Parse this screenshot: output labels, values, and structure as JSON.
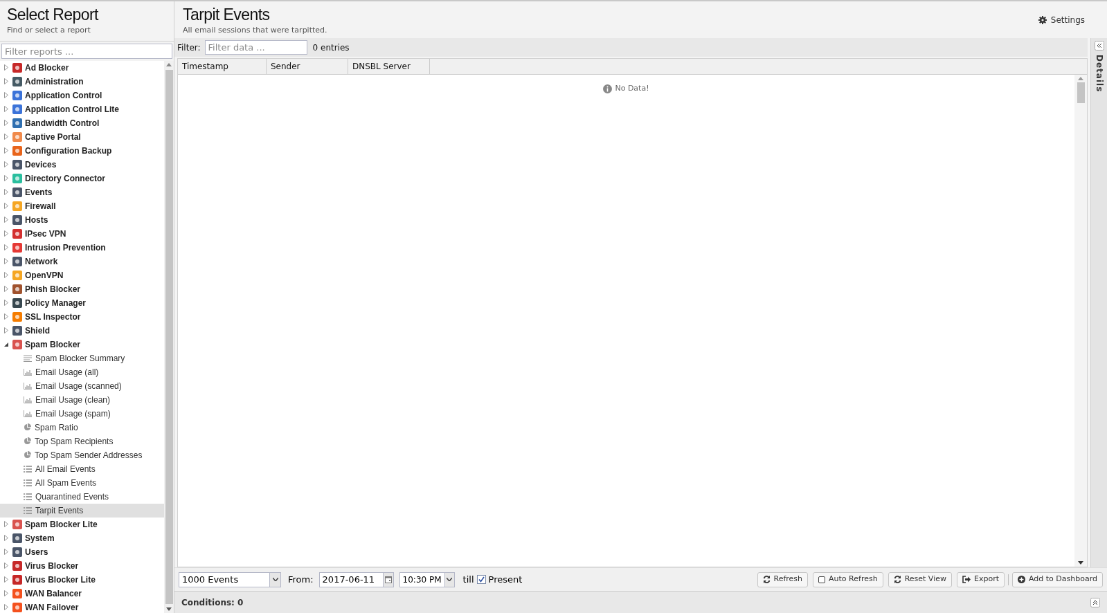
{
  "sidebar": {
    "title": "Select Report",
    "subtitle": "Find or select a report",
    "filter_placeholder": "Filter reports ...",
    "items": [
      {
        "label": "Ad Blocker",
        "color": "#c62828",
        "expanded": false
      },
      {
        "label": "Administration",
        "color": "#455a64",
        "expanded": false
      },
      {
        "label": "Application Control",
        "color": "#3b73d9",
        "expanded": false
      },
      {
        "label": "Application Control Lite",
        "color": "#3b73d9",
        "expanded": false
      },
      {
        "label": "Bandwidth Control",
        "color": "#2f6fb0",
        "expanded": false
      },
      {
        "label": "Captive Portal",
        "color": "#f08a4b",
        "expanded": false
      },
      {
        "label": "Configuration Backup",
        "color": "#e8641b",
        "expanded": false
      },
      {
        "label": "Devices",
        "color": "#4a5568",
        "expanded": false
      },
      {
        "label": "Directory Connector",
        "color": "#2bbf9f",
        "expanded": false
      },
      {
        "label": "Events",
        "color": "#4a5568",
        "expanded": false
      },
      {
        "label": "Firewall",
        "color": "#f5a623",
        "expanded": false
      },
      {
        "label": "Hosts",
        "color": "#4a5568",
        "expanded": false
      },
      {
        "label": "IPsec VPN",
        "color": "#d32f2f",
        "expanded": false
      },
      {
        "label": "Intrusion Prevention",
        "color": "#e53935",
        "expanded": false
      },
      {
        "label": "Network",
        "color": "#4a5568",
        "expanded": false
      },
      {
        "label": "OpenVPN",
        "color": "#f5a623",
        "expanded": false
      },
      {
        "label": "Phish Blocker",
        "color": "#a0522d",
        "expanded": false
      },
      {
        "label": "Policy Manager",
        "color": "#37474f",
        "expanded": false
      },
      {
        "label": "SSL Inspector",
        "color": "#f57c00",
        "expanded": false
      },
      {
        "label": "Shield",
        "color": "#4a5568",
        "expanded": false
      },
      {
        "label": "Spam Blocker",
        "color": "#d9534f",
        "expanded": true,
        "children": [
          {
            "label": "Spam Blocker Summary",
            "kind": "summary",
            "selected": false
          },
          {
            "label": "Email Usage (all)",
            "kind": "bar",
            "selected": false
          },
          {
            "label": "Email Usage (scanned)",
            "kind": "bar",
            "selected": false
          },
          {
            "label": "Email Usage (clean)",
            "kind": "bar",
            "selected": false
          },
          {
            "label": "Email Usage (spam)",
            "kind": "bar",
            "selected": false
          },
          {
            "label": "Spam Ratio",
            "kind": "pie",
            "selected": false
          },
          {
            "label": "Top Spam Recipients",
            "kind": "pie",
            "selected": false
          },
          {
            "label": "Top Spam Sender Addresses",
            "kind": "pie",
            "selected": false
          },
          {
            "label": "All Email Events",
            "kind": "list",
            "selected": false
          },
          {
            "label": "All Spam Events",
            "kind": "list",
            "selected": false
          },
          {
            "label": "Quarantined Events",
            "kind": "list",
            "selected": false
          },
          {
            "label": "Tarpit Events",
            "kind": "list",
            "selected": true
          }
        ]
      },
      {
        "label": "Spam Blocker Lite",
        "color": "#d9534f",
        "expanded": false
      },
      {
        "label": "System",
        "color": "#4a5568",
        "expanded": false
      },
      {
        "label": "Users",
        "color": "#4a5568",
        "expanded": false
      },
      {
        "label": "Virus Blocker",
        "color": "#c62828",
        "expanded": false
      },
      {
        "label": "Virus Blocker Lite",
        "color": "#c62828",
        "expanded": false
      },
      {
        "label": "WAN Balancer",
        "color": "#f4511e",
        "expanded": false
      },
      {
        "label": "WAN Failover",
        "color": "#f4511e",
        "expanded": false
      }
    ]
  },
  "report": {
    "title": "Tarpit Events",
    "subtitle": "All email sessions that were tarpitted.",
    "settings": "Settings",
    "filter_label": "Filter:",
    "filter_placeholder": "Filter data ...",
    "entries": "0 entries",
    "columns": [
      "Timestamp",
      "Sender",
      "DNSBL Server"
    ],
    "empty_message": "No Data!",
    "limit": "1000 Events",
    "from_label": "From:",
    "from_date": "2017-06-11",
    "from_time": "10:30 PM",
    "till_label": "till",
    "present": {
      "label": "Present",
      "checked": true
    },
    "buttons": [
      {
        "label": "Refresh",
        "kind": "refresh"
      },
      {
        "label": "Auto Refresh",
        "kind": "checkbox",
        "checked": false
      },
      {
        "label": "Reset View",
        "kind": "refresh"
      },
      {
        "label": "Export",
        "kind": "export"
      },
      {
        "label": "Add to Dashboard",
        "kind": "add"
      }
    ],
    "conditions": "Conditions: 0",
    "details": "Details"
  }
}
